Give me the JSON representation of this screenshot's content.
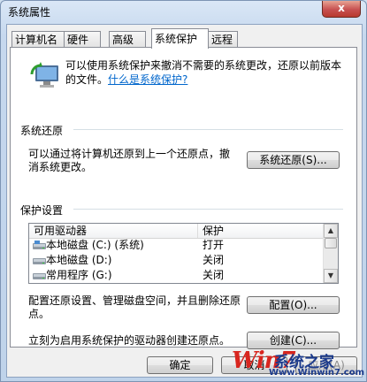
{
  "window": {
    "title": "系统属性",
    "close_label": "x"
  },
  "tabs": [
    {
      "label": "计算机名",
      "active": false
    },
    {
      "label": "硬件",
      "active": false
    },
    {
      "label": "高级",
      "active": false
    },
    {
      "label": "系统保护",
      "active": true
    },
    {
      "label": "远程",
      "active": false
    }
  ],
  "intro": {
    "text": "可以使用系统保护来撤消不需要的系统更改，还原以前版本的文件。",
    "link": "什么是系统保护?"
  },
  "restore": {
    "group_title": "系统还原",
    "text": "可以通过将计算机还原到上一个还原点，撤消系统更改。",
    "button": "系统还原(S)..."
  },
  "protection": {
    "group_title": "保护设置",
    "columns": {
      "drive": "可用驱动器",
      "protection": "保护"
    },
    "drives": [
      {
        "name": "本地磁盘 (C:) (系统)",
        "protection": "打开",
        "icon": "system-drive-icon"
      },
      {
        "name": "本地磁盘 (D:)",
        "protection": "关闭",
        "icon": "drive-icon"
      },
      {
        "name": "常用程序 (G:)",
        "protection": "关闭",
        "icon": "drive-icon"
      }
    ],
    "config_text": "配置还原设置、管理磁盘空间，并且删除还原点。",
    "config_button": "配置(O)...",
    "create_text": "立刻为启用系统保护的驱动器创建还原点。",
    "create_button": "创建(C)..."
  },
  "footer": {
    "ok": "确定",
    "cancel": "取消",
    "apply": "应用(A)"
  },
  "watermark": {
    "logo_text": "Win7",
    "brand": "系统之家",
    "url": "Www.Winwin7.com"
  },
  "colors": {
    "link": "#0066cc",
    "titlebar": "#c6d8ee",
    "close": "#c75050"
  }
}
